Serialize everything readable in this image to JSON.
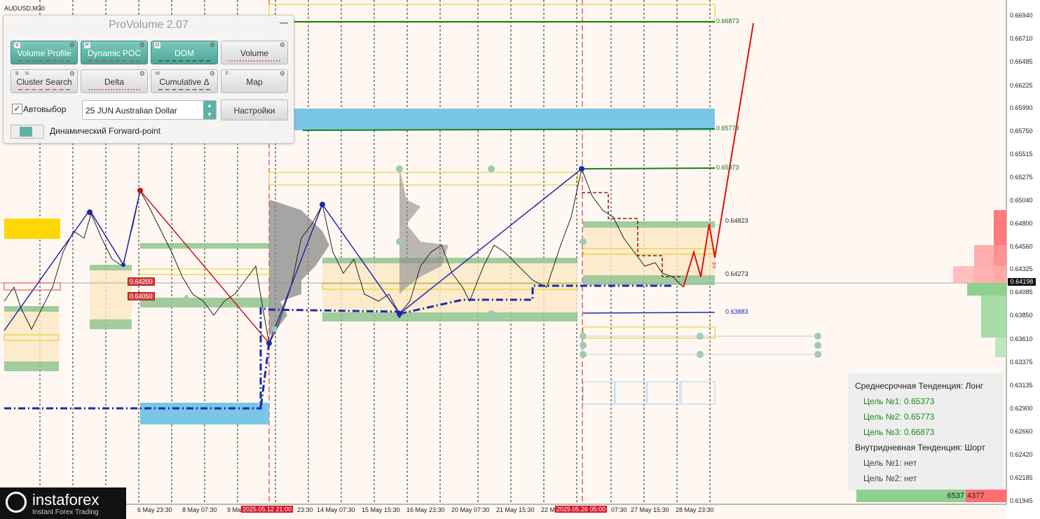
{
  "symbol": "AUDUSD,M30",
  "panel": {
    "title": "ProVolume 2.07",
    "buttons": [
      {
        "label": "Volume Profile",
        "key": "V",
        "active": true
      },
      {
        "label": "Dynamic POC",
        "key": "P",
        "active": true
      },
      {
        "label": "DOM",
        "key": "D",
        "active": true
      },
      {
        "label": "Volume",
        "key": "",
        "active": false
      },
      {
        "label": "Cluster Search",
        "key": "B",
        "key2": "N",
        "active": false
      },
      {
        "label": "Delta",
        "key": "",
        "active": false
      },
      {
        "label": "Cumulative Δ",
        "key": "M",
        "active": false
      },
      {
        "label": "Map",
        "key": "F",
        "active": false
      }
    ],
    "autoselect_label": "Автовыбор",
    "autoselect_checked": true,
    "instrument": "25 JUN Australian Dollar",
    "settings_label": "Настройки",
    "forward_point_label": "Динамический Forward-point"
  },
  "price_axis": [
    "0.66940",
    "0.66710",
    "0.66485",
    "0.66225",
    "0.65990",
    "0.65750",
    "0.65515",
    "0.65275",
    "0.65040",
    "0.64800",
    "0.64560",
    "0.64325",
    "0.64085",
    "0.63850",
    "0.63610",
    "0.63375",
    "0.63135",
    "0.62900",
    "0.62660",
    "0.62420",
    "0.62185",
    "0.61945"
  ],
  "current_price": "0.64198",
  "level_labels": [
    {
      "text": "0.66873"
    },
    {
      "text": "0.65773"
    },
    {
      "text": "0.65373"
    },
    {
      "text": "0.64823"
    },
    {
      "text": "0.64273"
    },
    {
      "text": "0.63883"
    }
  ],
  "chart_price_tags": [
    "0.64200",
    "0.64050"
  ],
  "time_axis": [
    "6 May 23:30",
    "8 May 07:30",
    "9 Ma",
    "14 May 07:30",
    "15 May 15:30",
    "16 May 23:30",
    "20 May 07:30",
    "21 May 15:30",
    "22 M",
    "07:30",
    "27 May 15:30",
    "28 May 23:30",
    "23:30"
  ],
  "time_highlights": [
    "2025.05.12 21:00",
    "2025.05.26 05:00"
  ],
  "trend_box": {
    "mid_title": "Среднесрочная Тенденция: Лонг",
    "mid_targets": [
      "Цель №1: 0.65373",
      "Цель №2: 0.65773",
      "Цель №3: 0.66873"
    ],
    "intra_title": "Внутридневная Тенденция: Шорт",
    "intra_targets": [
      "Цель №1: нет",
      "Цель №2: нет"
    ]
  },
  "volume_split": {
    "buy": "6537",
    "sell": "4377"
  },
  "logo": {
    "name": "instaforex",
    "tagline": "Instant Forex Trading"
  },
  "colors": {
    "accent": "#5fb3a6",
    "up_green": "#1a7f1a",
    "target_red": "#e01010",
    "zigzag_blue": "#1c2aa8",
    "sell_red": "#ff6f6f",
    "buy_green": "#8fd08f"
  }
}
